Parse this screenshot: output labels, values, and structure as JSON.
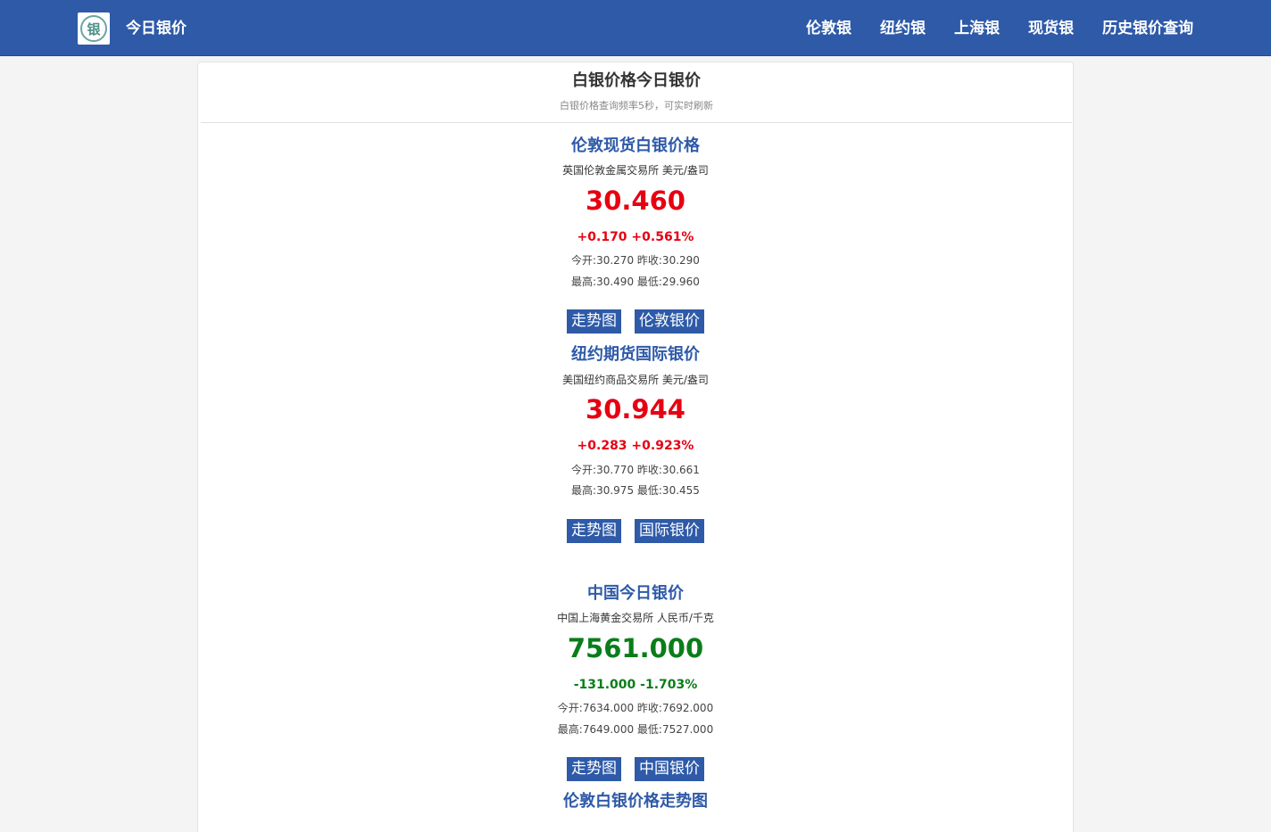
{
  "header": {
    "logo_char": "银",
    "site_title": "今日银价",
    "nav": [
      "伦敦银",
      "纽约银",
      "上海银",
      "现货银",
      "历史银价查询"
    ]
  },
  "panel": {
    "title": "白银价格今日银价",
    "subtitle": "白银价格查询频率5秒，可实时刷新"
  },
  "quotes": [
    {
      "title": "伦敦现货白银价格",
      "exchange": "英国伦敦金属交易所 美元/盎司",
      "price": "30.460",
      "change": "+0.170 +0.561%",
      "open_close": "今开:30.270 昨收:30.290",
      "high_low": "最高:30.490 最低:29.960",
      "buttons": [
        "走势图",
        "伦敦银价"
      ]
    },
    {
      "title": "纽约期货国际银价",
      "exchange": "美国纽约商品交易所 美元/盎司",
      "price": "30.944",
      "change": "+0.283 +0.923%",
      "open_close": "今开:30.770 昨收:30.661",
      "high_low": "最高:30.975 最低:30.455",
      "buttons": [
        "走势图",
        "国际银价"
      ]
    },
    {
      "title": "中国今日银价",
      "exchange": "中国上海黄金交易所 人民币/千克",
      "price": "7561.000",
      "change": "-131.000 -1.703%",
      "open_close": "今开:7634.000 昨收:7692.000",
      "high_low": "最高:7649.000 最低:7527.000",
      "buttons": [
        "走势图",
        "中国银价"
      ]
    }
  ],
  "chart_section_title": "伦敦白银价格走势图",
  "colors": {
    "brand": "#2e5aa8",
    "up": "#e60012",
    "down": "#0a7d1a"
  }
}
